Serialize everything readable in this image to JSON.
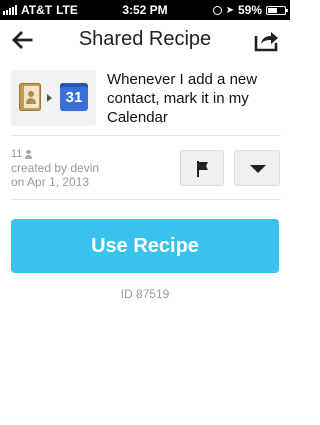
{
  "status_bar": {
    "carrier": "AT&T",
    "network": "LTE",
    "time": "3:52 PM",
    "battery": "59%",
    "battery_level": 0.59,
    "signal_bars": 5
  },
  "nav": {
    "title": "Shared Recipe",
    "back_icon": "arrow-left-icon",
    "share_icon": "share-icon"
  },
  "recipe": {
    "description": "Whenever I add a new contact, mark it in my Calendar",
    "trigger_icon": "contacts-icon",
    "action_icon": "calendar-icon",
    "calendar_day": "31",
    "user_count": "11",
    "created_by": "created by devin",
    "created_on": "on Apr 1, 2013"
  },
  "actions": {
    "use_label": "Use Recipe",
    "id_text": "ID 87519"
  },
  "colors": {
    "accent": "#38c2ec",
    "status_bg": "#000000"
  }
}
